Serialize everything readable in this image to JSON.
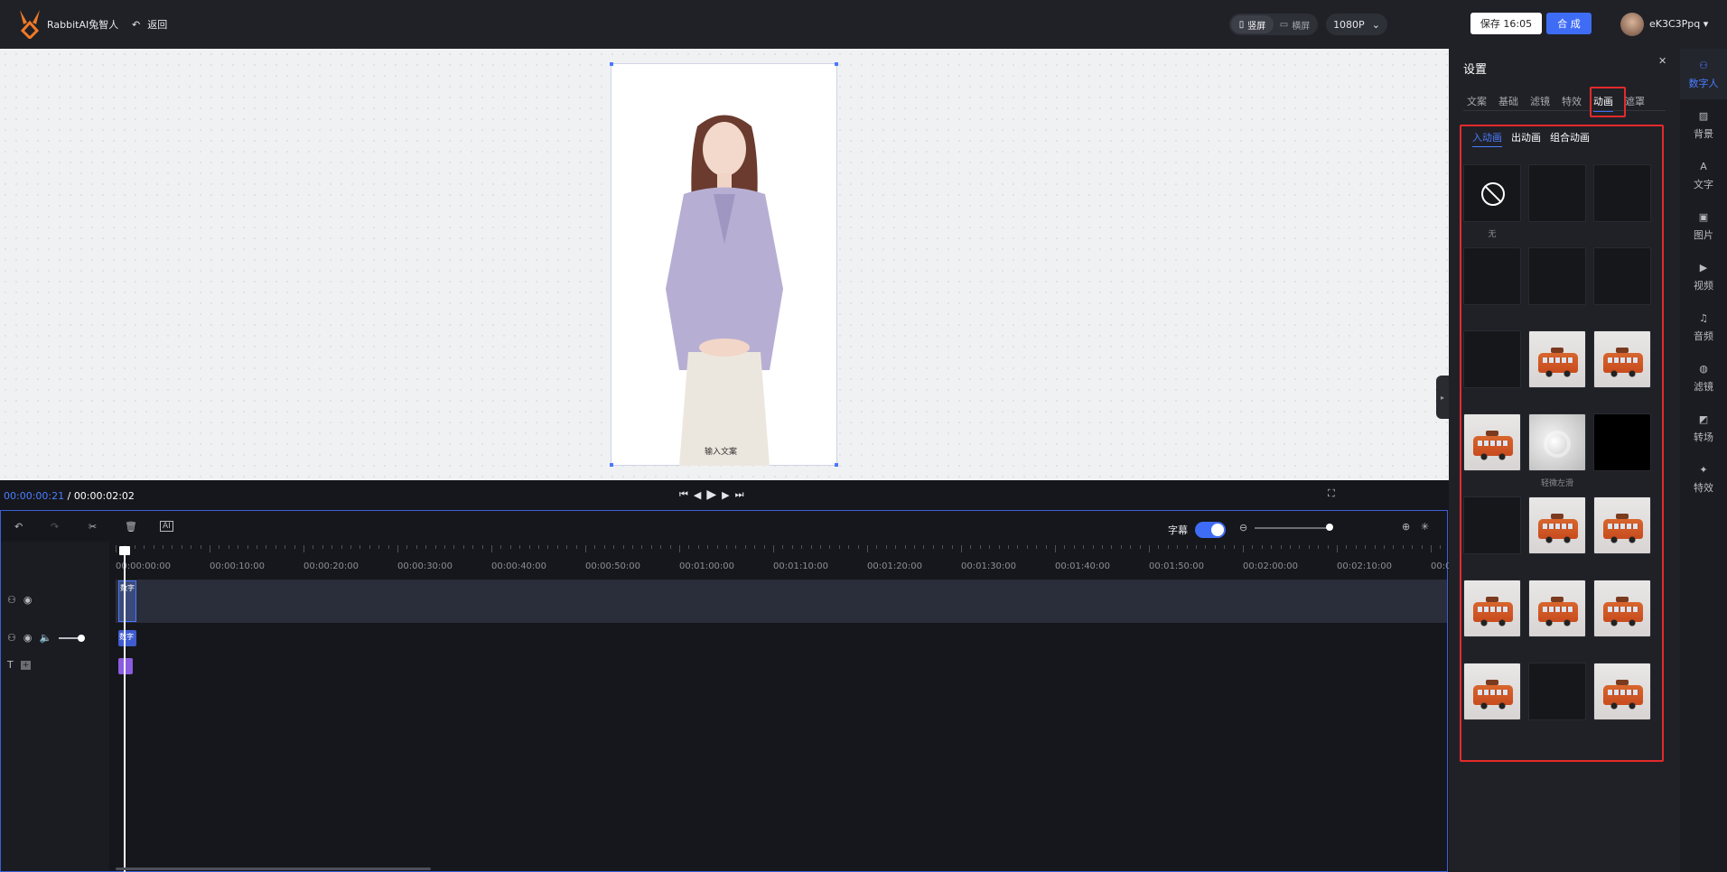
{
  "header": {
    "brand": "RabbitAI兔智人",
    "back_label": "返回",
    "orientation": {
      "portrait": "竖屏",
      "landscape": "横屏",
      "selected": "portrait"
    },
    "resolution": "1080P",
    "save_label": "保存 16:05",
    "synthesize_label": "合 成",
    "username": "eK3C3Ppq"
  },
  "canvas": {
    "caption": "输入文案"
  },
  "player": {
    "current_time": "00:00:00:21",
    "separator": " / ",
    "total_time": "00:00:02:02"
  },
  "timeline": {
    "subtitle_label": "字幕",
    "subtitle_on": true,
    "ruler_labels": [
      "00:00:00:00",
      "00:00:10:00",
      "00:00:20:00",
      "00:00:30:00",
      "00:00:40:00",
      "00:00:50:00",
      "00:01:00:00",
      "00:01:10:00",
      "00:01:20:00",
      "00:01:30:00",
      "00:01:40:00",
      "00:01:50:00",
      "00:02:00:00",
      "00:02:10:00",
      "00:0"
    ],
    "clip_label": "数字"
  },
  "panel": {
    "title": "设置",
    "tabs": [
      "文案",
      "基础",
      "滤镜",
      "特效",
      "动画",
      "遮罩"
    ],
    "active_tab": "动画",
    "subtabs": [
      "入动画",
      "出动画",
      "组合动画"
    ],
    "active_subtab": "入动画",
    "items": [
      {
        "label": "无",
        "kind": "none"
      },
      {
        "label": "",
        "kind": "blank"
      },
      {
        "label": "",
        "kind": "blank"
      },
      {
        "label": "",
        "kind": "blank"
      },
      {
        "label": "",
        "kind": "blank"
      },
      {
        "label": "",
        "kind": "blank"
      },
      {
        "label": "",
        "kind": "blank"
      },
      {
        "label": "",
        "kind": "bus"
      },
      {
        "label": "",
        "kind": "bus"
      },
      {
        "label": "",
        "kind": "bus"
      },
      {
        "label": "轻微左滑",
        "kind": "grey"
      },
      {
        "label": "",
        "kind": "dark"
      },
      {
        "label": "",
        "kind": "blank"
      },
      {
        "label": "",
        "kind": "bus"
      },
      {
        "label": "",
        "kind": "bus"
      },
      {
        "label": "",
        "kind": "bus"
      },
      {
        "label": "",
        "kind": "bus"
      },
      {
        "label": "",
        "kind": "bus"
      },
      {
        "label": "",
        "kind": "bus"
      },
      {
        "label": "",
        "kind": "blank"
      },
      {
        "label": "",
        "kind": "bus"
      }
    ]
  },
  "rail": [
    {
      "label": "数字人",
      "icon": "digital-human-icon",
      "active": true
    },
    {
      "label": "背景",
      "icon": "background-icon"
    },
    {
      "label": "文字",
      "icon": "text-icon"
    },
    {
      "label": "图片",
      "icon": "image-icon"
    },
    {
      "label": "视频",
      "icon": "video-icon"
    },
    {
      "label": "音频",
      "icon": "audio-icon"
    },
    {
      "label": "滤镜",
      "icon": "filter-icon"
    },
    {
      "label": "转场",
      "icon": "transition-icon"
    },
    {
      "label": "特效",
      "icon": "effects-icon"
    }
  ],
  "colors": {
    "accent": "#3f6cf5",
    "highlight": "#e42a2a",
    "panel_bg": "#202127"
  }
}
